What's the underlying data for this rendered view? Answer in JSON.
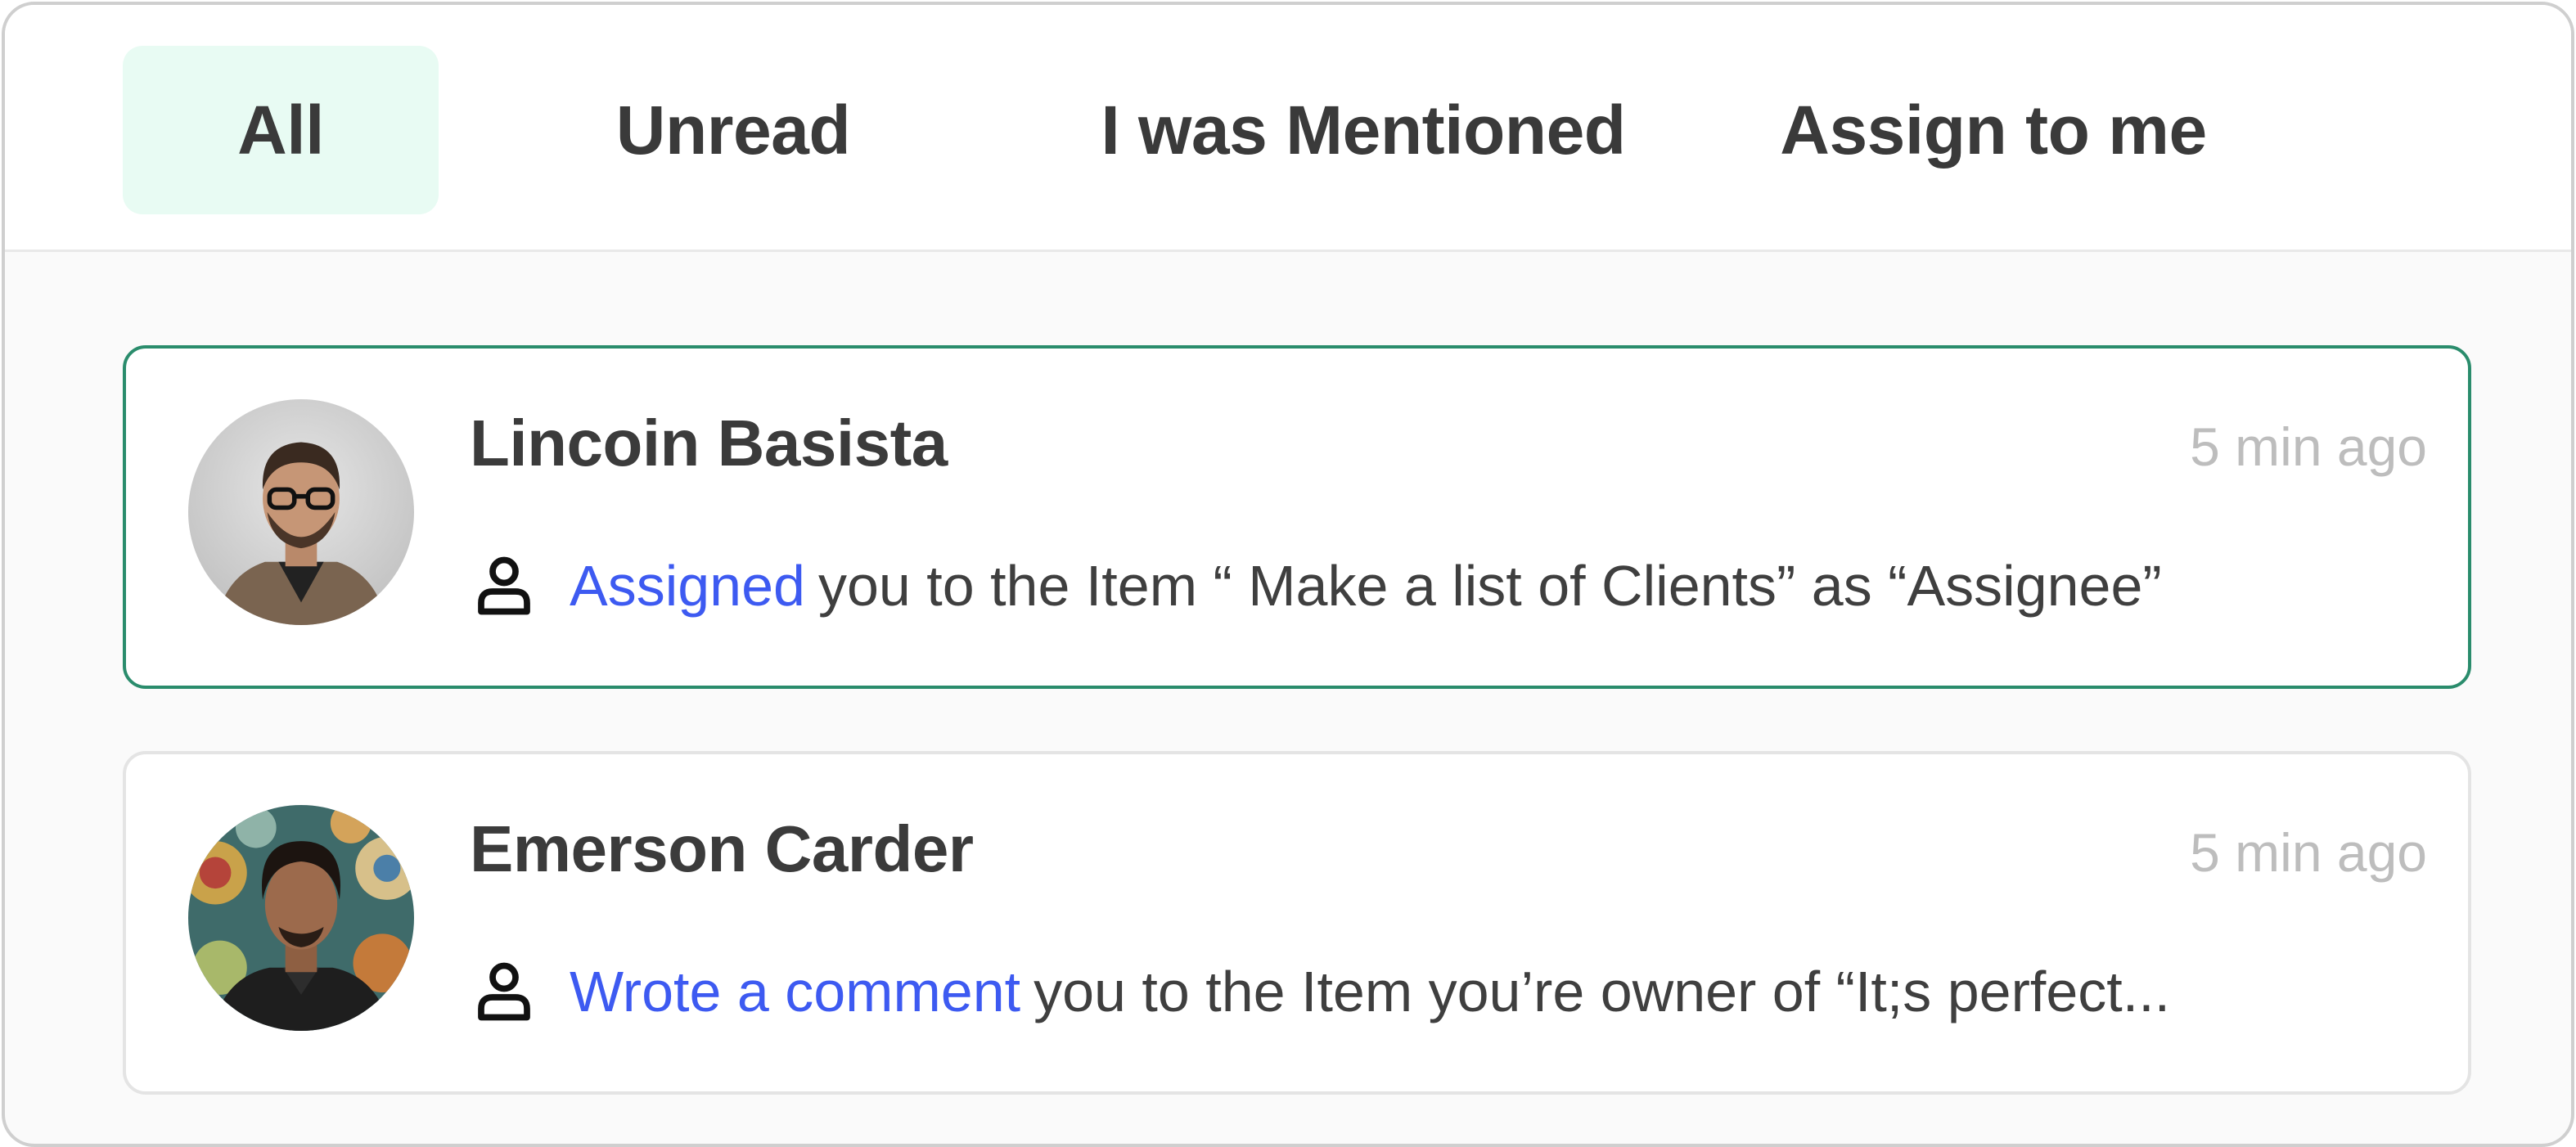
{
  "tabs": [
    {
      "label": "All",
      "active": true
    },
    {
      "label": "Unread",
      "active": false
    },
    {
      "label": "I was Mentioned",
      "active": false
    },
    {
      "label": "Assign to me",
      "active": false
    }
  ],
  "notifications": [
    {
      "name": "Lincoin Basista",
      "time": "5 min ago",
      "action": "Assigned",
      "message": "you to the Item “ Make a list of Clients” as “Assignee”",
      "avatar": "man-with-glasses-avatar",
      "icon": "user-icon",
      "highlighted": true
    },
    {
      "name": "Emerson Carder",
      "time": "5 min ago",
      "action": "Wrote a comment",
      "message": "you to the Item you’re owner of “It;s perfect...",
      "avatar": "man-patterned-background-avatar",
      "icon": "user-icon",
      "highlighted": false
    }
  ],
  "colors": {
    "active_tab_bg": "#e8fbf3",
    "highlight_border": "#2a8c6c",
    "action_link": "#3d5af1",
    "timestamp": "#bdbdbd"
  }
}
